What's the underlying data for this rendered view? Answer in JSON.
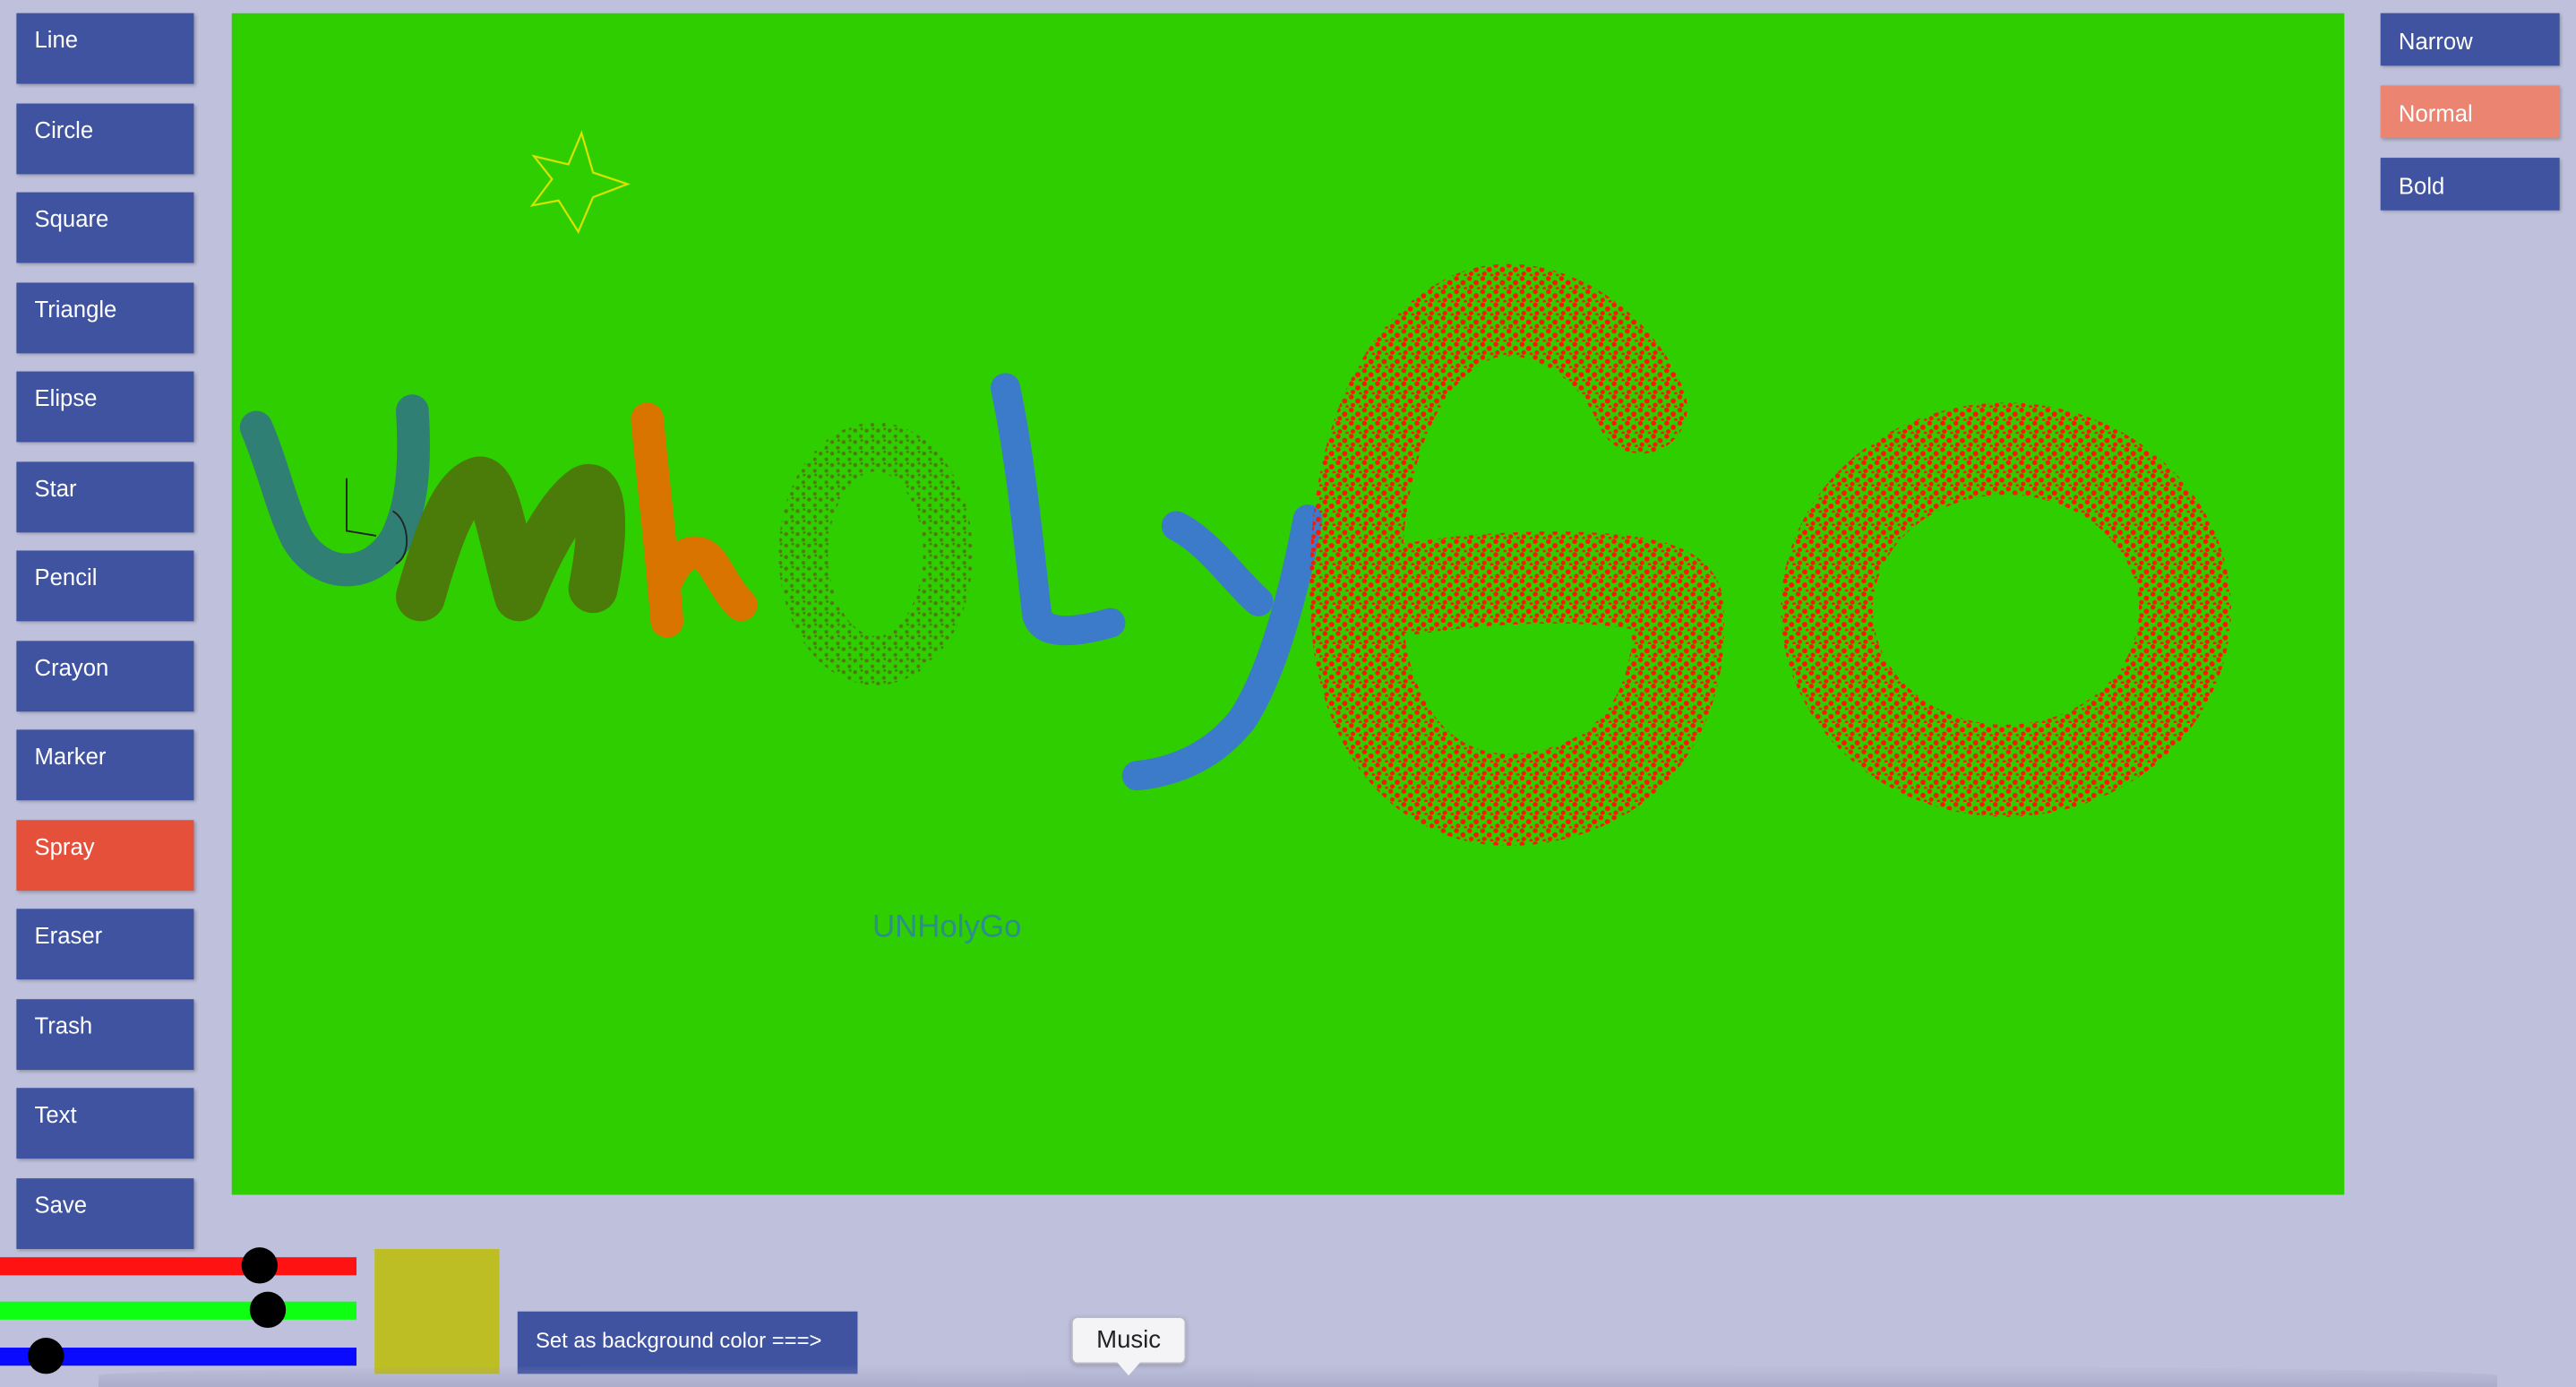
{
  "tools": [
    {
      "label": "Line",
      "icon": "line-icon"
    },
    {
      "label": "Circle",
      "icon": "circle-icon"
    },
    {
      "label": "Square",
      "icon": "square-icon"
    },
    {
      "label": "Triangle",
      "icon": "triangle-icon"
    },
    {
      "label": "Elipse",
      "icon": "ellipse-icon"
    },
    {
      "label": "Star",
      "icon": "star-icon"
    },
    {
      "label": "Pencil",
      "icon": "pencil-icon"
    },
    {
      "label": "Crayon",
      "icon": "crayon-icon"
    },
    {
      "label": "Marker",
      "icon": "marker-icon"
    },
    {
      "label": "Spray",
      "icon": "spray-icon",
      "active": true
    },
    {
      "label": "Eraser",
      "icon": "eraser-icon"
    },
    {
      "label": "Trash",
      "icon": "trash-icon"
    },
    {
      "label": "Text",
      "icon": "text-icon"
    },
    {
      "label": "Save",
      "icon": "save-icon"
    }
  ],
  "widths": [
    {
      "label": "Narrow"
    },
    {
      "label": "Normal",
      "active": true
    },
    {
      "label": "Bold"
    }
  ],
  "canvas": {
    "background": "#2fce00",
    "text_label": "UNHolyGo"
  },
  "color_picker": {
    "red": 0.73,
    "green": 0.75,
    "blue": 0.13,
    "swatch": "#bdbd24"
  },
  "actions": {
    "set_background": "Set as background color ===>",
    "music": "Music"
  },
  "colors": {
    "accent": "#3f53a1",
    "active_tool": "#e5503a",
    "active_width": "#ec8472",
    "page_bg": "#bfc1dc"
  }
}
